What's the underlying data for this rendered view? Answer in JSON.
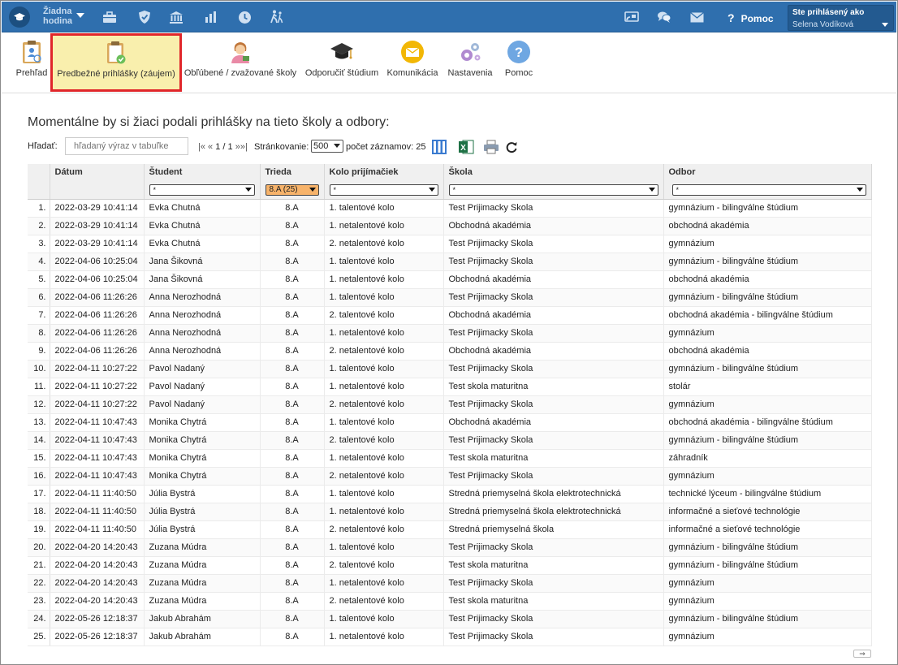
{
  "topbar": {
    "hodina_label": "Žiadna hodina",
    "help_label": "Pomoc",
    "login_title": "Ste prihlásený ako",
    "login_user": "Selena Vodíková"
  },
  "toolbar": {
    "items": [
      {
        "label": "Prehľad",
        "icon": "clipboard-person-icon"
      },
      {
        "label": "Predbežné prihlášky (záujem)",
        "icon": "clipboard-check-icon"
      },
      {
        "label": "Obľúbené / zvažované školy",
        "icon": "student-girl-icon"
      },
      {
        "label": "Odporučiť štúdium",
        "icon": "graduation-cap-icon"
      },
      {
        "label": "Komunikácia",
        "icon": "envelope-icon"
      },
      {
        "label": "Nastavenia",
        "icon": "gears-icon"
      },
      {
        "label": "Pomoc",
        "icon": "question-icon"
      }
    ]
  },
  "main": {
    "heading": "Momentálne by si žiaci podali prihlášky na tieto školy a odbory:",
    "search_label": "Hľadať:",
    "search_placeholder": "hľadaný výraz v tabuľke",
    "pager_first": "|«",
    "pager_prev": "«",
    "pager_pages": "1 / 1",
    "pager_next": "»",
    "pager_last": "»|",
    "paging_label": "Stránkovanie:",
    "page_size": "500",
    "record_count": "počet záznamov: 25"
  },
  "table": {
    "columns": [
      "Dátum",
      "Študent",
      "Trieda",
      "Kolo prijímačiek",
      "Škola",
      "Odbor"
    ],
    "filters": [
      "",
      "*",
      "8.A (25)",
      "*",
      "*",
      "*"
    ],
    "rows": [
      [
        "1.",
        "2022-03-29 10:41:14",
        "Evka Chutná",
        "8.A",
        "1. talentové kolo",
        "Test Prijimacky Skola",
        "gymnázium - bilingválne štúdium"
      ],
      [
        "2.",
        "2022-03-29 10:41:14",
        "Evka Chutná",
        "8.A",
        "1. netalentové kolo",
        "Obchodná akadémia",
        "obchodná akadémia"
      ],
      [
        "3.",
        "2022-03-29 10:41:14",
        "Evka Chutná",
        "8.A",
        "2. netalentové kolo",
        "Test Prijimacky Skola",
        "gymnázium"
      ],
      [
        "4.",
        "2022-04-06 10:25:04",
        "Jana Šikovná",
        "8.A",
        "1. talentové kolo",
        "Test Prijimacky Skola",
        "gymnázium - bilingválne štúdium"
      ],
      [
        "5.",
        "2022-04-06 10:25:04",
        "Jana Šikovná",
        "8.A",
        "1. netalentové kolo",
        "Obchodná akadémia",
        "obchodná akadémia"
      ],
      [
        "6.",
        "2022-04-06 11:26:26",
        "Anna Nerozhodná",
        "8.A",
        "1. talentové kolo",
        "Test Prijimacky Skola",
        "gymnázium - bilingválne štúdium"
      ],
      [
        "7.",
        "2022-04-06 11:26:26",
        "Anna Nerozhodná",
        "8.A",
        "2. talentové kolo",
        "Obchodná akadémia",
        "obchodná akadémia - bilingválne štúdium"
      ],
      [
        "8.",
        "2022-04-06 11:26:26",
        "Anna Nerozhodná",
        "8.A",
        "1. netalentové kolo",
        "Test Prijimacky Skola",
        "gymnázium"
      ],
      [
        "9.",
        "2022-04-06 11:26:26",
        "Anna Nerozhodná",
        "8.A",
        "2. netalentové kolo",
        "Obchodná akadémia",
        "obchodná akadémia"
      ],
      [
        "10.",
        "2022-04-11 10:27:22",
        "Pavol Nadaný",
        "8.A",
        "1. talentové kolo",
        "Test Prijimacky Skola",
        "gymnázium - bilingválne štúdium"
      ],
      [
        "11.",
        "2022-04-11 10:27:22",
        "Pavol Nadaný",
        "8.A",
        "1. netalentové kolo",
        "Test skola maturitna",
        "stolár"
      ],
      [
        "12.",
        "2022-04-11 10:27:22",
        "Pavol Nadaný",
        "8.A",
        "2. netalentové kolo",
        "Test Prijimacky Skola",
        "gymnázium"
      ],
      [
        "13.",
        "2022-04-11 10:47:43",
        "Monika Chytrá",
        "8.A",
        "1. talentové kolo",
        "Obchodná akadémia",
        "obchodná akadémia - bilingválne štúdium"
      ],
      [
        "14.",
        "2022-04-11 10:47:43",
        "Monika Chytrá",
        "8.A",
        "2. talentové kolo",
        "Test Prijimacky Skola",
        "gymnázium - bilingválne štúdium"
      ],
      [
        "15.",
        "2022-04-11 10:47:43",
        "Monika Chytrá",
        "8.A",
        "1. netalentové kolo",
        "Test skola maturitna",
        "záhradník"
      ],
      [
        "16.",
        "2022-04-11 10:47:43",
        "Monika Chytrá",
        "8.A",
        "2. netalentové kolo",
        "Test Prijimacky Skola",
        "gymnázium"
      ],
      [
        "17.",
        "2022-04-11 11:40:50",
        "Júlia Bystrá",
        "8.A",
        "1. talentové kolo",
        "Stredná priemyselná škola elektrotechnická",
        "technické lýceum - bilingválne štúdium"
      ],
      [
        "18.",
        "2022-04-11 11:40:50",
        "Júlia Bystrá",
        "8.A",
        "1. netalentové kolo",
        "Stredná priemyselná škola elektrotechnická",
        "informačné a sieťové technológie"
      ],
      [
        "19.",
        "2022-04-11 11:40:50",
        "Júlia Bystrá",
        "8.A",
        "2. netalentové kolo",
        "Stredná priemyselná škola",
        "informačné a sieťové technológie"
      ],
      [
        "20.",
        "2022-04-20 14:20:43",
        "Zuzana Múdra",
        "8.A",
        "1. talentové kolo",
        "Test Prijimacky Skola",
        "gymnázium - bilingválne štúdium"
      ],
      [
        "21.",
        "2022-04-20 14:20:43",
        "Zuzana Múdra",
        "8.A",
        "2. talentové kolo",
        "Test skola maturitna",
        "gymnázium - bilingválne štúdium"
      ],
      [
        "22.",
        "2022-04-20 14:20:43",
        "Zuzana Múdra",
        "8.A",
        "1. netalentové kolo",
        "Test Prijimacky Skola",
        "gymnázium"
      ],
      [
        "23.",
        "2022-04-20 14:20:43",
        "Zuzana Múdra",
        "8.A",
        "2. netalentové kolo",
        "Test skola maturitna",
        "gymnázium"
      ],
      [
        "24.",
        "2022-05-26 12:18:37",
        "Jakub Abrahám",
        "8.A",
        "1. talentové kolo",
        "Test Prijimacky Skola",
        "gymnázium - bilingválne štúdium"
      ],
      [
        "25.",
        "2022-05-26 12:18:37",
        "Jakub Abrahám",
        "8.A",
        "1. netalentové kolo",
        "Test Prijimacky Skola",
        "gymnázium"
      ]
    ]
  },
  "scroll_arrow": "⇒"
}
